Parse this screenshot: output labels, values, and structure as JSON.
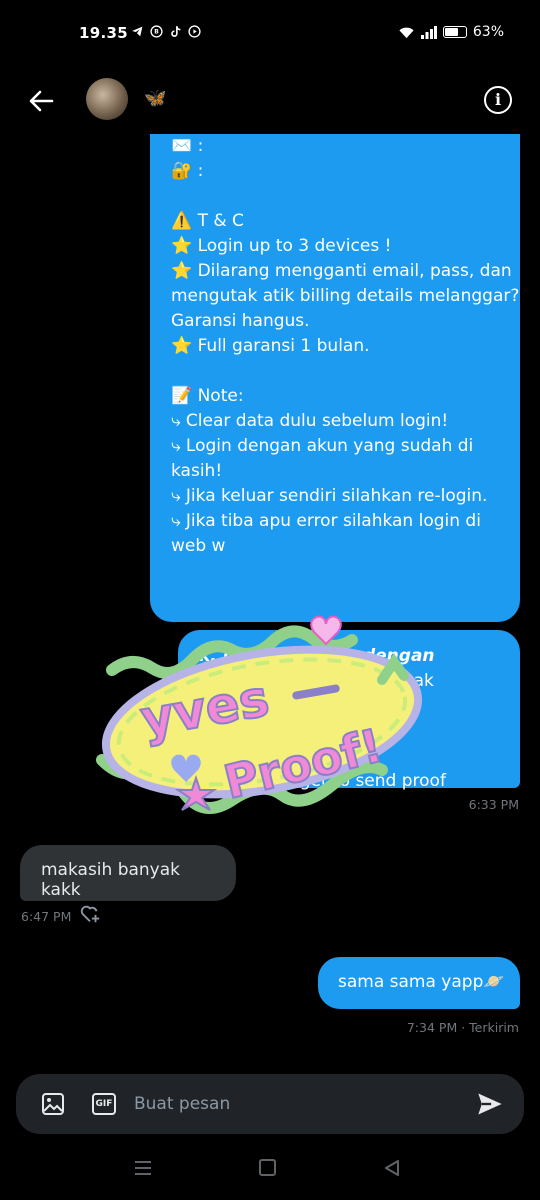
{
  "status": {
    "time": "19.35",
    "battery": "63%",
    "left_icons": [
      "telegram-icon",
      "b-icon",
      "tiktok-icon",
      "play-icon"
    ]
  },
  "header": {
    "contact_emoji": "🦋"
  },
  "messages": {
    "outgoing_1": {
      "lines": [
        "✉️ :",
        "🔐 :",
        "",
        "⚠️ T & C",
        "⭐ Login up to 3 devices !",
        "⭐ Dilarang mengganti email, pass, dan",
        "mengutak atik billing details melanggar?",
        "Garansi hangus.",
        "⭐ Full garansi 1 bulan.",
        "",
        "📝 Note:",
        "⤷ Clear data dulu sebelum login!",
        "⤷ Login dengan akun yang sudah di",
        "kasih!",
        "⤷ Jika keluar sendiri silahkan re-login.",
        "⤷ Jika tiba apu error silahkan login di",
        "web w"
      ]
    },
    "outgoing_2": {
      "bold_line": "k, mohon dibaca dengan",
      "lines": [
        "baik ya terimakasih banyak selamat",
        "menonton🫶🥳💞",
        "",
        "💌 Don't forget to send proof"
      ],
      "time": "6:33 PM"
    },
    "incoming_1": {
      "text": "makasih banyak kakk",
      "time": "6:47 PM"
    },
    "outgoing_3": {
      "text": "sama sama yapp🪐",
      "time_status": "7:34 PM · Terkirim"
    }
  },
  "sticker": {
    "line1": "yves",
    "line2": "Proof!"
  },
  "composer": {
    "placeholder": "Buat pesan",
    "gif_label": "GIF"
  },
  "colors": {
    "accent": "#1d9bf0",
    "incoming_bg": "#2f3336",
    "background": "#000000"
  }
}
